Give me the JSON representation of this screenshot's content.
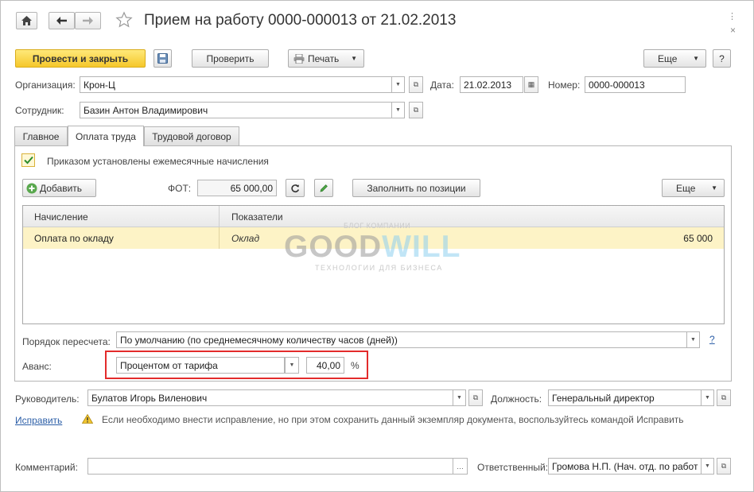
{
  "window": {
    "title": "Прием на работу 0000-000013 от 21.02.2013"
  },
  "toolbar": {
    "post_close": "Провести и закрыть",
    "check": "Проверить",
    "print": "Печать",
    "more": "Еще",
    "help": "?"
  },
  "header": {
    "org_label": "Организация:",
    "org_value": "Крон-Ц",
    "date_label": "Дата:",
    "date_value": "21.02.2013",
    "number_label": "Номер:",
    "number_value": "0000-000013",
    "employee_label": "Сотрудник:",
    "employee_value": "Базин Антон Владимирович"
  },
  "tabs": [
    "Главное",
    "Оплата труда",
    "Трудовой договор"
  ],
  "pay": {
    "monthly_checkbox_label": "Приказом установлены ежемесячные начисления",
    "monthly_checked": true,
    "add_button": "Добавить",
    "fot_label": "ФОТ:",
    "fot_value": "65 000,00",
    "fill_button": "Заполнить по позиции",
    "more": "Еще",
    "columns": [
      "Начисление",
      "Показатели"
    ],
    "rows": [
      {
        "accrual": "Оплата по окладу",
        "indicator": "Оклад",
        "value": "65 000"
      }
    ],
    "recalc_label": "Порядок пересчета:",
    "recalc_value": "По умолчанию (по среднемесячному количеству часов (дней))",
    "recalc_help": "?",
    "advance_label": "Аванс:",
    "advance_method": "Процентом от тарифа",
    "advance_value": "40,00",
    "advance_unit": "%"
  },
  "watermark": {
    "top": "БЛОГ КОМПАНИИ",
    "brand_a": "GOOD",
    "brand_b": "WILL",
    "bottom": "ТЕХНОЛОГИИ ДЛЯ БИЗНЕСА"
  },
  "footer": {
    "manager_label": "Руководитель:",
    "manager_value": "Булатов Игорь Виленович",
    "position_label": "Должность:",
    "position_value": "Генеральный директор",
    "fix_link": "Исправить",
    "fix_hint": "Если необходимо внести исправление, но при этом сохранить данный экземпляр документа, воспользуйтесь командой Исправить",
    "comment_label": "Комментарий:",
    "comment_value": "",
    "responsible_label": "Ответственный:",
    "responsible_value": "Громова Н.П. (Нач. отд. по работ"
  },
  "colors": {
    "primary_button": "#f5c72a",
    "highlight_box": "#e32b2b",
    "link": "#2b5ea7",
    "selected_row": "#fdf3c6"
  }
}
